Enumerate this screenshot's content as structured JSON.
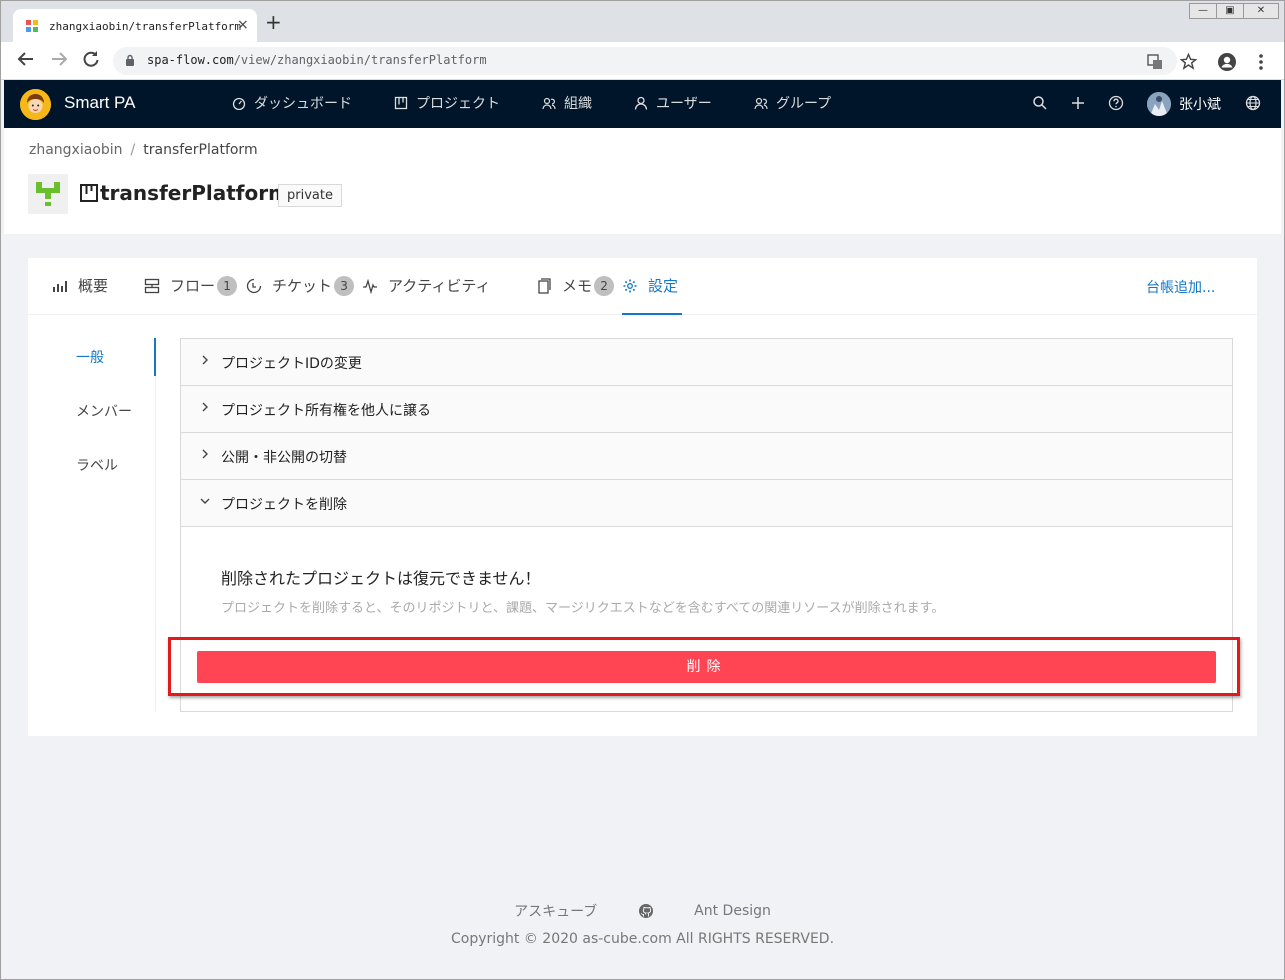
{
  "browser": {
    "tab_title": "zhangxiaobin/transferPlatform",
    "tab_close": "×",
    "new_tab": "+",
    "url_host": "spa-flow.com",
    "url_path": "/view/zhangxiaobin/transferPlatform"
  },
  "header": {
    "brand": "Smart PA",
    "menu": [
      "ダッシュボード",
      "プロジェクト",
      "組織",
      "ユーザー",
      "グループ"
    ],
    "username": "张小斌"
  },
  "project": {
    "breadcrumb_owner": "zhangxiaobin",
    "breadcrumb_sep": "/",
    "breadcrumb_project": "transferPlatform",
    "name": "transferPlatform",
    "visibility": "private"
  },
  "tabs": [
    {
      "label": "概要",
      "badge": null
    },
    {
      "label": "フロー",
      "badge": "1"
    },
    {
      "label": "チケット",
      "badge": "3"
    },
    {
      "label": "アクティビティ",
      "badge": null
    },
    {
      "label": "メモ",
      "badge": "2"
    },
    {
      "label": "設定",
      "badge": null
    }
  ],
  "add_link": "台帳追加...",
  "sidebar": [
    "一般",
    "メンバー",
    "ラベル"
  ],
  "panels": [
    "プロジェクトIDの変更",
    "プロジェクト所有権を他人に譲る",
    "公開・非公開の切替",
    "プロジェクトを削除"
  ],
  "delete_section": {
    "warning_title": "削除されたプロジェクトは復元できません！",
    "warning_desc": "プロジェクトを削除すると、そのリポジトリと、課題、マージリクエストなどを含むすべての関連リソースが削除されます。",
    "button": "削除"
  },
  "footer": {
    "link1": "アスキューブ",
    "link2": "Ant Design",
    "copyright": "Copyright © 2020 as-cube.com All RIGHTS RESERVED."
  },
  "colors": {
    "header_bg": "#001529",
    "accent": "#1478c8",
    "danger": "#ff4553"
  }
}
